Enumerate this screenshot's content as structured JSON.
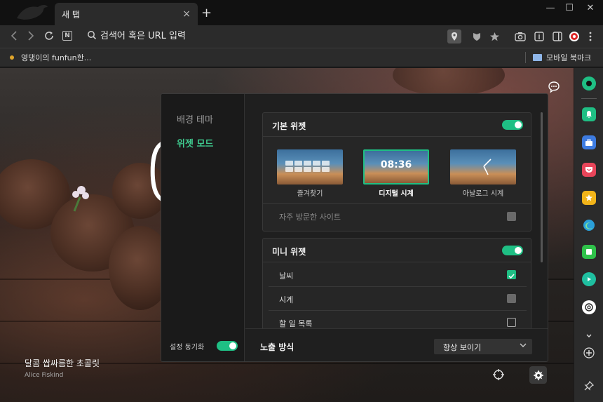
{
  "browser": {
    "tab_title": "새 탭",
    "tab_close": "×",
    "new_tab": "+",
    "window_controls": {
      "minimize": "—",
      "maximize": "☐",
      "close": "✕"
    }
  },
  "address_bar": {
    "placeholder": "검색어 혹은 URL 입력",
    "n_badge": "N"
  },
  "bookmarks": {
    "item_label": "영댕이의 funfun한...",
    "mobile_label": "모바일 북마크"
  },
  "background": {
    "clock_text": "0",
    "caption": "달콤 쌉싸름한 초콜릿",
    "credit": "Alice Fiskind"
  },
  "settings": {
    "menu_background": "배경 테마",
    "menu_widget": "위젯 모드",
    "sync_label": "설정 동기화",
    "basic_widget_title": "기본 위젯",
    "thumbs": [
      {
        "label": "즐겨찾기",
        "selected": false
      },
      {
        "label": "디지털 시계",
        "selected": true,
        "time": "08:36"
      },
      {
        "label": "아날로그 시계",
        "selected": false
      }
    ],
    "frequent_sites": "자주 방문한 사이트",
    "mini_widget_title": "미니 위젯",
    "mini_rows": [
      {
        "label": "날씨",
        "state": "checked"
      },
      {
        "label": "시계",
        "state": "gray"
      },
      {
        "label": "할 일 목록",
        "state": "empty"
      }
    ],
    "expose_label": "노출 방식",
    "expose_value": "항상 보이기"
  },
  "colors": {
    "accent": "#1fbf84",
    "menu_active": "#3fcb8f"
  },
  "icons": {
    "sidebar": [
      "naver-green-icon",
      "alarm-icon",
      "briefcase-icon",
      "pocket-icon",
      "star-icon",
      "edge-icon",
      "green-square-icon",
      "play-icon",
      "chatgpt-icon",
      "chevron-down-icon",
      "add-icon",
      "pin-icon"
    ]
  }
}
